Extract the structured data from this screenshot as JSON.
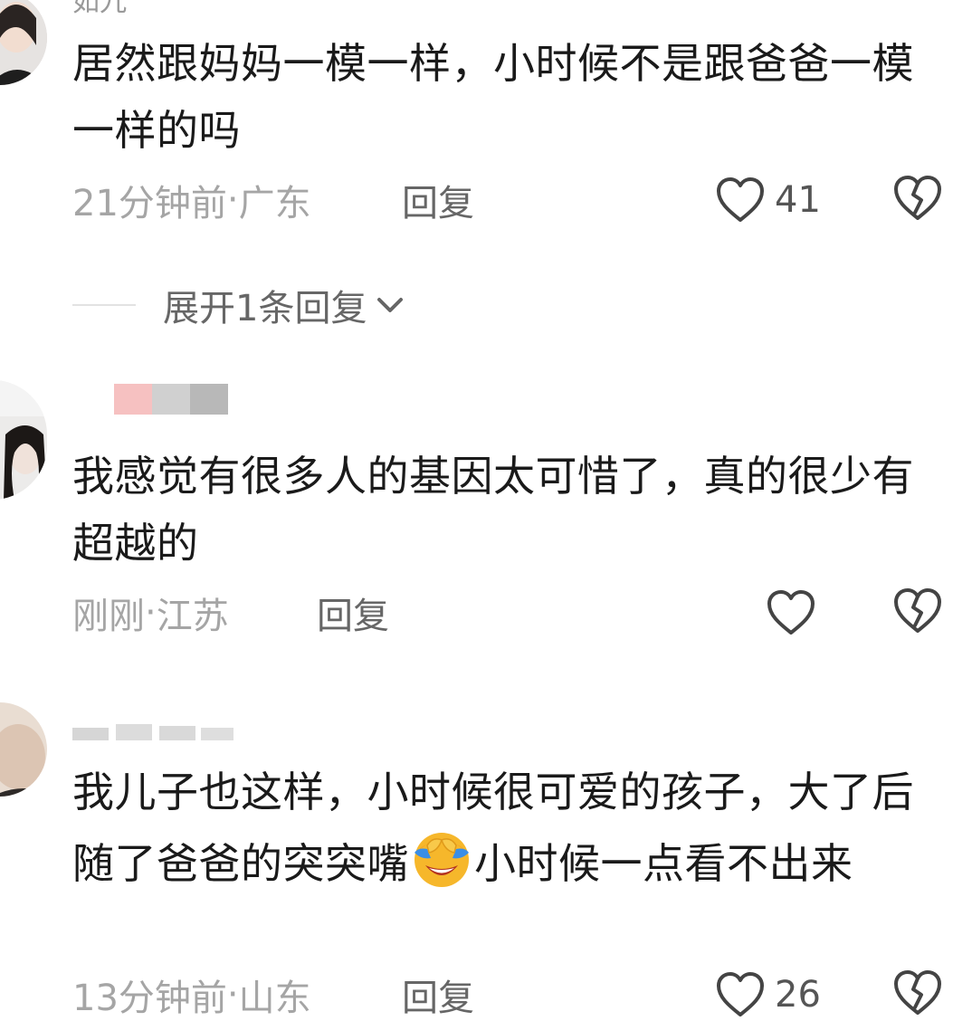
{
  "comments": [
    {
      "username": "如九",
      "text": "居然跟妈妈一模一样，小时候不是跟爸爸一模一样的吗",
      "time": "21分钟前",
      "location": "广东",
      "reply_label": "回复",
      "likes": "41",
      "expand_label": "展开1条回复"
    },
    {
      "username": "",
      "text": "我感觉有很多人的基因太可惜了，真的很少有超越的",
      "time": "刚刚",
      "location": "江苏",
      "reply_label": "回复",
      "likes": ""
    },
    {
      "username": "",
      "text_before_emoji": "我儿子也这样，小时候很可爱的孩子，大了后随了爸爸的突突嘴",
      "text_after_emoji": "小时候一点看不出来",
      "emoji": "face-with-tears-of-joy-covering-eyes",
      "time": "13分钟前",
      "location": "山东",
      "reply_label": "回复",
      "likes": "26"
    }
  ],
  "separator": " · ",
  "icons": {
    "like": "heart-outline-icon",
    "dislike": "broken-heart-icon",
    "expand": "chevron-down-icon"
  },
  "colors": {
    "text": "#1a1a1a",
    "meta": "#a5a5a5",
    "reply": "#666666",
    "icon": "#444444"
  }
}
